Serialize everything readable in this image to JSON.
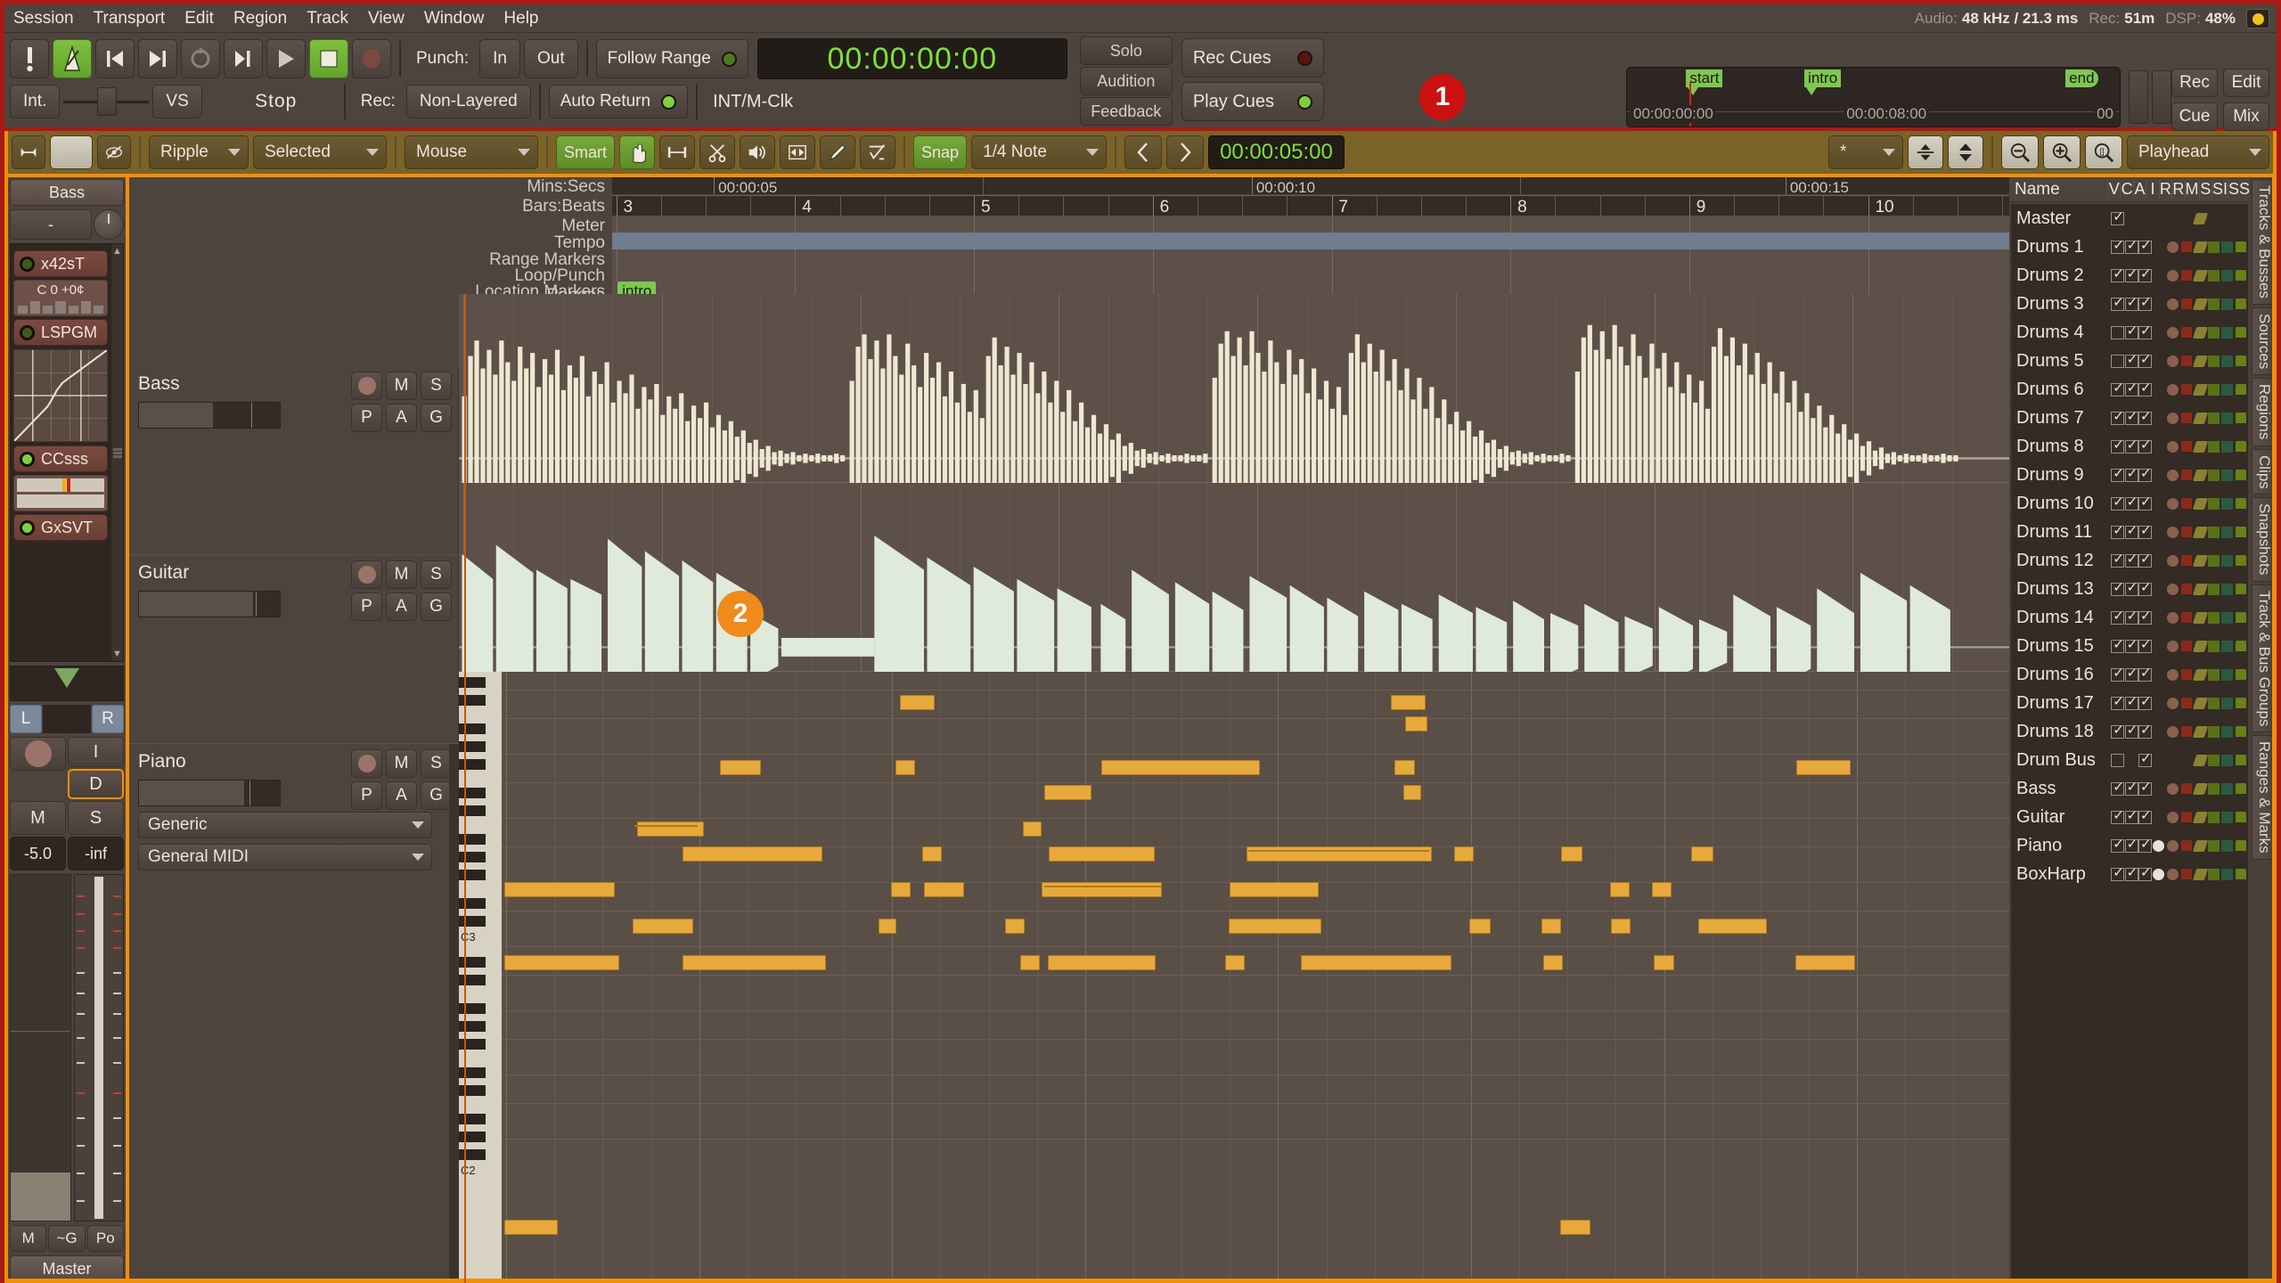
{
  "menu": {
    "items": [
      "Session",
      "Transport",
      "Edit",
      "Region",
      "Track",
      "View",
      "Window",
      "Help"
    ]
  },
  "status": {
    "audio_label": "Audio:",
    "audio_value": "48 kHz / 21.3 ms",
    "rec_label": "Rec:",
    "rec_value": "51m",
    "dsp_label": "DSP:",
    "dsp_value": "48%"
  },
  "transport": {
    "midi_panic_icon": "exclamation-icon",
    "metronome_icon": "metronome-icon",
    "go_start_icon": "go-to-start-icon",
    "go_end_icon": "go-to-end-icon",
    "loop_icon": "loop-icon",
    "play_range_icon": "play-range-icon",
    "play_icon": "play-icon",
    "stop_icon": "stop-icon",
    "record_icon": "record-icon",
    "punch_label": "Punch:",
    "punch_in": "In",
    "punch_out": "Out",
    "follow_range": "Follow Range",
    "primary_clock": "00:00:00:00",
    "sync_source": "Int.",
    "varispeed": "VS",
    "transport_state": "Stop",
    "rec_label": "Rec:",
    "rec_mode": "Non-Layered",
    "auto_return": "Auto Return",
    "clock_source": "INT/M-Clk",
    "solo": "Solo",
    "audition": "Audition",
    "feedback": "Feedback",
    "rec_cues": "Rec Cues",
    "play_cues": "Play Cues",
    "rec_button": "Rec",
    "edit_button": "Edit",
    "cue_button": "Cue",
    "mix_button": "Mix"
  },
  "mini_timeline": {
    "markers": [
      {
        "label": "start",
        "left_pct": 12
      },
      {
        "label": "intro",
        "left_pct": 36
      },
      {
        "label": "end",
        "left_pct": 89
      }
    ],
    "times": [
      "00:00:00:00",
      "00:00:08:00",
      "00"
    ]
  },
  "annotations": [
    {
      "id": "1",
      "color": "#cc1111"
    },
    {
      "id": "2",
      "color": "#f08a1a"
    }
  ],
  "edit_toolbar": {
    "shrink_icon": "expand-horizontal-icon",
    "visibility_icon": "eye-slash-icon",
    "strip_name": "Bass",
    "edit_mode": "Ripple",
    "edit_point": "Selected",
    "edit_target": "Mouse",
    "smart_mode": "Smart",
    "tools": [
      {
        "name": "grab-tool-icon",
        "active": true
      },
      {
        "name": "range-tool-icon",
        "active": false
      },
      {
        "name": "cut-tool-icon",
        "active": false
      },
      {
        "name": "audition-tool-icon",
        "active": false
      },
      {
        "name": "stretch-tool-icon",
        "active": false
      },
      {
        "name": "draw-tool-icon",
        "active": false
      },
      {
        "name": "edit-content-tool-icon",
        "active": false
      }
    ],
    "snap": "Snap",
    "grid_value": "1/4 Note",
    "nudge_back_icon": "chevron-left-icon",
    "nudge_forward_icon": "chevron-right-icon",
    "nudge_clock": "00:00:05:00",
    "marker_star": "*",
    "fit_tracks_icon": "fit-tracks-icon",
    "track_height_icon": "track-height-icon",
    "zoom_out_icon": "zoom-out-icon",
    "zoom_in_icon": "zoom-in-icon",
    "zoom_fit_icon": "zoom-to-session-icon",
    "zoom_focus": "Playhead"
  },
  "mixer_strip": {
    "name": "Bass",
    "input_label": "-",
    "trim_knob": "trim-knob",
    "processors": [
      {
        "name": "x42sT",
        "led": "dim",
        "sub_text": "C  0    +0¢"
      },
      {
        "name": "LSPGM",
        "led": "dim"
      },
      {
        "name": "CCsss",
        "led": "on"
      },
      {
        "name": "GxSVT",
        "led": "on"
      }
    ],
    "pan_left": "L",
    "pan_right": "R",
    "input_btn": "I",
    "disk_btn": "D",
    "mute": "M",
    "solo": "S",
    "gain": "-5.0",
    "peak": "-inf",
    "bottom": {
      "mute": "M",
      "group": "~G",
      "meter_point": "Po"
    },
    "master": "Master"
  },
  "rulers": {
    "labels": [
      "Mins:Secs",
      "Bars:Beats",
      "Meter",
      "Tempo",
      "Range Markers",
      "Loop/Punch Ranges",
      "Location Markers"
    ],
    "minsecs_ticks": [
      {
        "label": "00:00:05",
        "left_pct": 7.5
      },
      {
        "label": "00:00:10",
        "left_pct": 46
      },
      {
        "label": "00:00:15",
        "left_pct": 84
      }
    ],
    "bars": [
      {
        "label": "3",
        "left_pct": 0.4
      },
      {
        "label": "4",
        "left_pct": 13.2
      },
      {
        "label": "5",
        "left_pct": 26.0
      },
      {
        "label": "6",
        "left_pct": 38.8
      },
      {
        "label": "7",
        "left_pct": 51.6
      },
      {
        "label": "8",
        "left_pct": 64.4
      },
      {
        "label": "9",
        "left_pct": 77.2
      },
      {
        "label": "10",
        "left_pct": 90.0
      }
    ],
    "location_marker": "intro"
  },
  "tracks": [
    {
      "name": "Bass",
      "type": "audio",
      "mute": "M",
      "solo": "S",
      "p": "P",
      "a": "A",
      "g": "G",
      "rec_icon": "record-dot-icon"
    },
    {
      "name": "Guitar",
      "type": "audio",
      "mute": "M",
      "solo": "S",
      "p": "P",
      "a": "A",
      "g": "G",
      "rec_icon": "record-dot-icon"
    },
    {
      "name": "Piano",
      "type": "midi",
      "mute": "M",
      "solo": "S",
      "p": "P",
      "a": "A",
      "g": "G",
      "rec_icon": "record-dot-icon",
      "midi_channel_selector": "Generic",
      "patch_selector": "General MIDI"
    }
  ],
  "track_list": {
    "header": {
      "name": "Name",
      "cols": [
        "V",
        "C",
        "A",
        "I",
        "R",
        "R",
        "M",
        "S",
        "SI",
        "SS"
      ]
    },
    "rows": [
      {
        "name": "Master",
        "v": true,
        "c": false,
        "a": false,
        "i": false,
        "rec": false,
        "lock": false,
        "pencil": true,
        "sqg": false,
        "sqt": false,
        "lockg": false
      },
      {
        "name": "Drums 1",
        "v": true,
        "c": true,
        "a": true,
        "i": false,
        "rec": true,
        "lock": true,
        "pencil": true,
        "sqg": true,
        "sqt": true,
        "lockg": true
      },
      {
        "name": "Drums 2",
        "v": true,
        "c": true,
        "a": true,
        "i": false,
        "rec": true,
        "lock": true,
        "pencil": true,
        "sqg": true,
        "sqt": true,
        "lockg": true
      },
      {
        "name": "Drums 3",
        "v": true,
        "c": true,
        "a": true,
        "i": false,
        "rec": true,
        "lock": true,
        "pencil": true,
        "sqg": true,
        "sqt": true,
        "lockg": true
      },
      {
        "name": "Drums 4",
        "v": false,
        "c": true,
        "a": true,
        "i": false,
        "rec": true,
        "lock": true,
        "pencil": true,
        "sqg": true,
        "sqt": true,
        "lockg": true
      },
      {
        "name": "Drums 5",
        "v": false,
        "c": true,
        "a": true,
        "i": false,
        "rec": true,
        "lock": true,
        "pencil": true,
        "sqg": true,
        "sqt": true,
        "lockg": true
      },
      {
        "name": "Drums 6",
        "v": true,
        "c": true,
        "a": true,
        "i": false,
        "rec": true,
        "lock": true,
        "pencil": true,
        "sqg": true,
        "sqt": true,
        "lockg": true
      },
      {
        "name": "Drums 7",
        "v": true,
        "c": true,
        "a": true,
        "i": false,
        "rec": true,
        "lock": true,
        "pencil": true,
        "sqg": true,
        "sqt": true,
        "lockg": true
      },
      {
        "name": "Drums 8",
        "v": true,
        "c": true,
        "a": true,
        "i": false,
        "rec": true,
        "lock": true,
        "pencil": true,
        "sqg": true,
        "sqt": true,
        "lockg": true
      },
      {
        "name": "Drums 9",
        "v": true,
        "c": true,
        "a": true,
        "i": false,
        "rec": true,
        "lock": true,
        "pencil": true,
        "sqg": true,
        "sqt": true,
        "lockg": true
      },
      {
        "name": "Drums 10",
        "v": true,
        "c": true,
        "a": true,
        "i": false,
        "rec": true,
        "lock": true,
        "pencil": true,
        "sqg": true,
        "sqt": true,
        "lockg": true
      },
      {
        "name": "Drums 11",
        "v": true,
        "c": true,
        "a": true,
        "i": false,
        "rec": true,
        "lock": true,
        "pencil": true,
        "sqg": true,
        "sqt": true,
        "lockg": true
      },
      {
        "name": "Drums 12",
        "v": true,
        "c": true,
        "a": true,
        "i": false,
        "rec": true,
        "lock": true,
        "pencil": true,
        "sqg": true,
        "sqt": true,
        "lockg": true
      },
      {
        "name": "Drums 13",
        "v": true,
        "c": true,
        "a": true,
        "i": false,
        "rec": true,
        "lock": true,
        "pencil": true,
        "sqg": true,
        "sqt": true,
        "lockg": true
      },
      {
        "name": "Drums 14",
        "v": true,
        "c": true,
        "a": true,
        "i": false,
        "rec": true,
        "lock": true,
        "pencil": true,
        "sqg": true,
        "sqt": true,
        "lockg": true
      },
      {
        "name": "Drums 15",
        "v": true,
        "c": true,
        "a": true,
        "i": false,
        "rec": true,
        "lock": true,
        "pencil": true,
        "sqg": true,
        "sqt": true,
        "lockg": true
      },
      {
        "name": "Drums 16",
        "v": true,
        "c": true,
        "a": true,
        "i": false,
        "rec": true,
        "lock": true,
        "pencil": true,
        "sqg": true,
        "sqt": true,
        "lockg": true
      },
      {
        "name": "Drums 17",
        "v": true,
        "c": true,
        "a": true,
        "i": false,
        "rec": true,
        "lock": true,
        "pencil": true,
        "sqg": true,
        "sqt": true,
        "lockg": true
      },
      {
        "name": "Drums 18",
        "v": true,
        "c": true,
        "a": true,
        "i": false,
        "rec": true,
        "lock": true,
        "pencil": true,
        "sqg": true,
        "sqt": true,
        "lockg": true
      },
      {
        "name": "Drum Bus",
        "v": false,
        "c": false,
        "a": true,
        "i": false,
        "rec": false,
        "lock": false,
        "pencil": true,
        "sqg": true,
        "sqt": true,
        "lockg": true
      },
      {
        "name": "Bass",
        "v": true,
        "c": true,
        "a": true,
        "i": false,
        "rec": true,
        "lock": true,
        "pencil": true,
        "sqg": true,
        "sqt": true,
        "lockg": true
      },
      {
        "name": "Guitar",
        "v": true,
        "c": true,
        "a": true,
        "i": false,
        "rec": true,
        "lock": true,
        "pencil": true,
        "sqg": true,
        "sqt": true,
        "lockg": true
      },
      {
        "name": "Piano",
        "v": true,
        "c": true,
        "a": true,
        "i": true,
        "rec": true,
        "lock": true,
        "pencil": true,
        "sqg": true,
        "sqt": true,
        "lockg": true
      },
      {
        "name": "BoxHarp",
        "v": true,
        "c": true,
        "a": true,
        "i": true,
        "rec": true,
        "lock": true,
        "pencil": true,
        "sqg": true,
        "sqt": true,
        "lockg": true
      }
    ],
    "side_tabs": [
      "Tracks & Busses",
      "Sources",
      "Regions",
      "Clips",
      "Snapshots",
      "Track & Bus Groups",
      "Ranges & Marks"
    ]
  }
}
